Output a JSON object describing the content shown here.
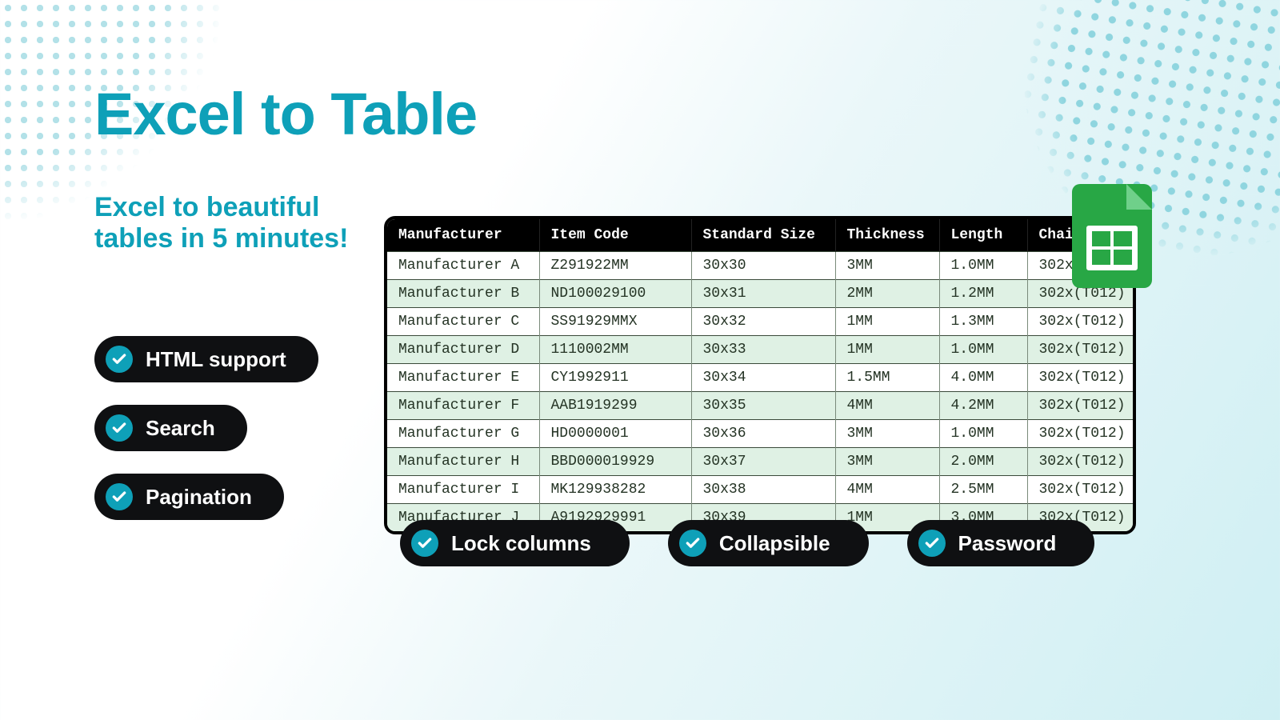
{
  "heading": "Excel to Table",
  "subheading": "Excel to beautiful tables in 5 minutes!",
  "side_features": [
    {
      "label": "HTML support"
    },
    {
      "label": "Search"
    },
    {
      "label": "Pagination"
    }
  ],
  "bottom_features": [
    {
      "label": "Lock columns"
    },
    {
      "label": "Collapsible"
    },
    {
      "label": "Password"
    }
  ],
  "table": {
    "headers": [
      "Manufacturer",
      "Item Code",
      "Standard Size",
      "Thickness",
      "Length",
      "Chain"
    ],
    "rows": [
      [
        "Manufacturer A",
        "Z291922MM",
        "30x30",
        "3MM",
        "1.0MM",
        "302x(T012)"
      ],
      [
        "Manufacturer B",
        "ND100029100",
        "30x31",
        "2MM",
        "1.2MM",
        "302x(T012)"
      ],
      [
        "Manufacturer C",
        "SS91929MMX",
        "30x32",
        "1MM",
        "1.3MM",
        "302x(T012)"
      ],
      [
        "Manufacturer D",
        "1110002MM",
        "30x33",
        "1MM",
        "1.0MM",
        "302x(T012)"
      ],
      [
        "Manufacturer E",
        "CY1992911",
        "30x34",
        "1.5MM",
        "4.0MM",
        "302x(T012)"
      ],
      [
        "Manufacturer F",
        "AAB1919299",
        "30x35",
        "4MM",
        "4.2MM",
        "302x(T012)"
      ],
      [
        "Manufacturer G",
        "HD0000001",
        "30x36",
        "3MM",
        "1.0MM",
        "302x(T012)"
      ],
      [
        "Manufacturer H",
        "BBD000019929",
        "30x37",
        "3MM",
        "2.0MM",
        "302x(T012)"
      ],
      [
        "Manufacturer I",
        "MK129938282",
        "30x38",
        "4MM",
        "2.5MM",
        "302x(T012)"
      ],
      [
        "Manufacturer J",
        "A9192929991",
        "30x39",
        "1MM",
        "3.0MM",
        "302x(T012)"
      ]
    ]
  },
  "badge": {
    "name": "google-sheets"
  }
}
